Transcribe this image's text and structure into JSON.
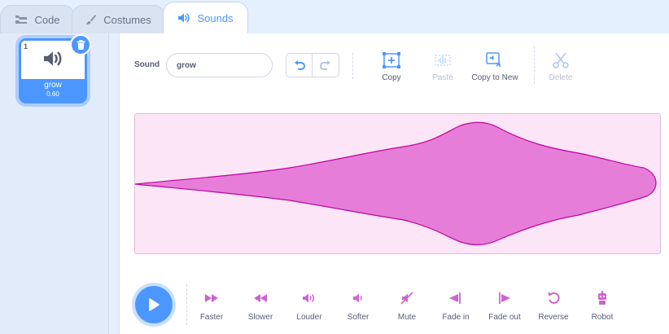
{
  "tabs": [
    {
      "label": "Code",
      "icon": "code-icon"
    },
    {
      "label": "Costumes",
      "icon": "brush-icon"
    },
    {
      "label": "Sounds",
      "icon": "speaker-icon"
    }
  ],
  "sound_list": {
    "items": [
      {
        "number": "1",
        "name": "grow",
        "duration": "0.60",
        "icon": "speaker-icon"
      }
    ]
  },
  "editor": {
    "sound_label": "Sound",
    "sound_name": "grow",
    "tools": {
      "copy": "Copy",
      "paste": "Paste",
      "copy_to_new": "Copy to New",
      "delete": "Delete"
    },
    "waveform": {
      "fill": "#e67ed9",
      "stroke": "#c300a0",
      "background": "#fce5f6"
    },
    "effects": {
      "faster": "Faster",
      "slower": "Slower",
      "louder": "Louder",
      "softer": "Softer",
      "mute": "Mute",
      "fade_in": "Fade in",
      "fade_out": "Fade out",
      "reverse": "Reverse",
      "robot": "Robot"
    }
  },
  "colors": {
    "accent": "#4c97ff",
    "effect": "#cf63cf",
    "text": "#575e75"
  }
}
